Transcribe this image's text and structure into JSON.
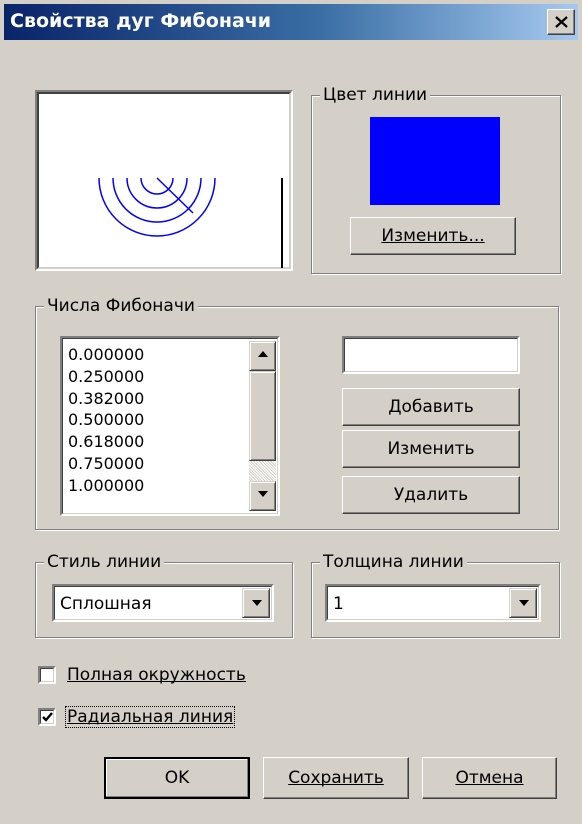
{
  "window": {
    "title": "Свойства дуг Фибоначи",
    "close_icon": "close-icon"
  },
  "line_color": {
    "legend": "Цвет линии",
    "color": "#0000ff",
    "change_button": "Изменить..."
  },
  "fibonacci": {
    "legend": "Числа Фибоначи",
    "values": [
      "0.000000",
      "0.250000",
      "0.382000",
      "0.500000",
      "0.618000",
      "0.750000",
      "1.000000"
    ],
    "input_value": "",
    "add_button": "Добавить",
    "edit_button": "Изменить",
    "delete_button": "Удалить"
  },
  "line_style": {
    "legend": "Стиль линии",
    "selected": "Сплошная"
  },
  "line_width": {
    "legend": "Толщина линии",
    "selected": "1"
  },
  "options": {
    "full_circle": {
      "label": "Полная окружность",
      "checked": false
    },
    "radial_line": {
      "label": "Радиальная линия",
      "checked": true
    }
  },
  "buttons": {
    "ok": "OK",
    "save": "Сохранить",
    "cancel": "Отмена"
  },
  "colors": {
    "preview_arc": "#0000ff",
    "titlebar_start": "#0a246a",
    "titlebar_end": "#a6caf0"
  }
}
